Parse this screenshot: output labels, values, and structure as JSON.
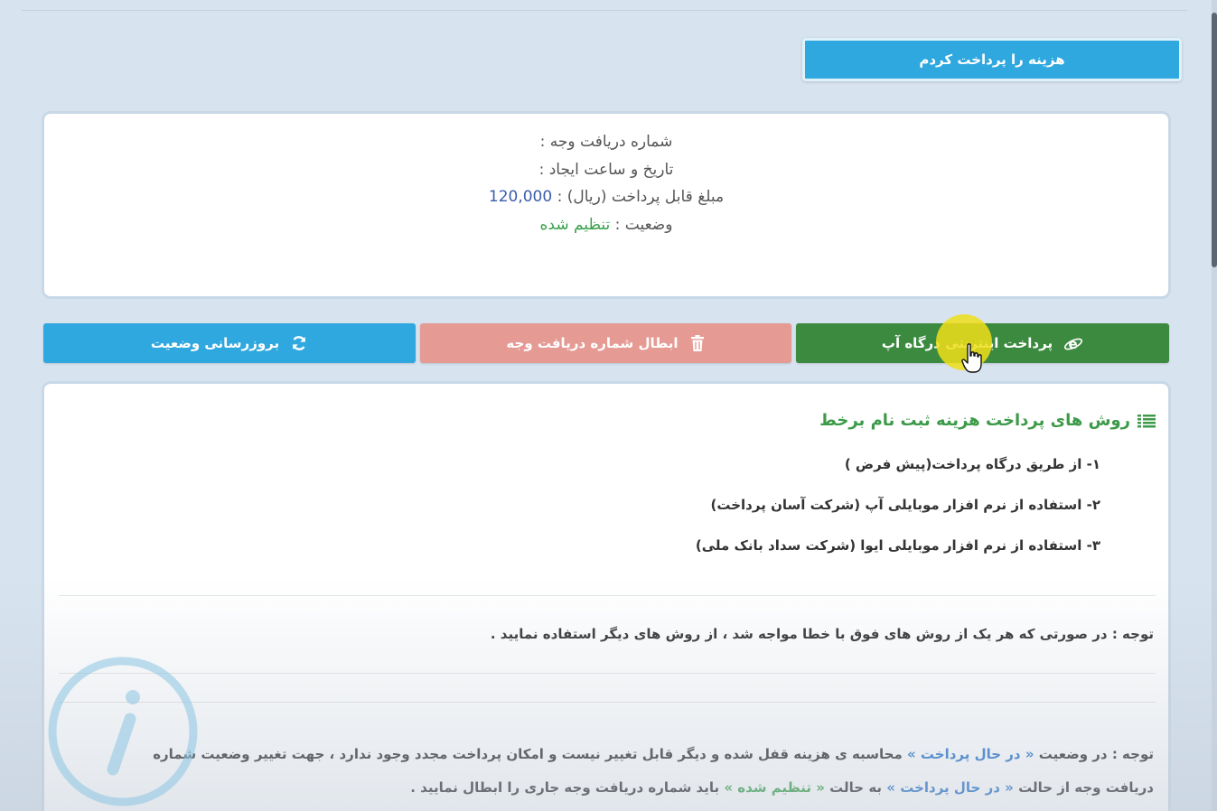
{
  "header": {
    "paid_button_label": "هزینه را پرداخت کردم"
  },
  "payment_info": {
    "receipt_number_label": "شماره دریافت وجه :",
    "created_datetime_label": "تاریخ و ساعت ایجاد :",
    "amount_label": "مبلغ قابل پرداخت (ریال) :",
    "amount_value": "120,000",
    "status_label": "وضعیت :",
    "status_value": "تنظیم شده"
  },
  "actions": {
    "pay_label": "پرداخت اینترنتی درگاه آپ",
    "cancel_label": "ابطال شماره دریافت وجه",
    "refresh_label": "بروزرسانی وضعیت"
  },
  "methods": {
    "title": "روش های پرداخت هزینه ثبت نام برخط",
    "items": [
      "۱- از طریق درگاه پرداخت(پیش فرض )",
      "۲- استفاده از نرم افزار موبایلی آپ (شرکت آسان پرداخت)",
      "۳- استفاده از نرم افزار موبایلی ایوا (شرکت سداد بانک ملی)"
    ],
    "note1": "توجه : در صورتی که هر یک از روش های فوق با خطا مواجه شد ، از روش های دیگر استفاده نمایید .",
    "note2": {
      "p1": "توجه : در وضعیت ",
      "status_paying": "« در حال پرداخت »",
      "p2": " محاسبه ی هزینه قفل شده و دیگر قابل تغییر نیست و امکان پرداخت مجدد وجود ندارد ، جهت تغییر وضعیت شماره دریافت وجه از حالت ",
      "p3": " به حالت ",
      "status_set": "« تنظیم شده »",
      "p4": " باید شماره دریافت وجه جاری را ابطال نمایید ."
    }
  },
  "colors": {
    "primary_blue": "#2fa8df",
    "success_green": "#3c8a40",
    "danger_pink": "#e69a94",
    "title_green": "#3c9a48",
    "link_blue": "#2a73c9",
    "highlight_yellow": "#eede1a"
  },
  "icons": {
    "pay": "internet-explorer-icon",
    "cancel": "trash-icon",
    "refresh": "refresh-icon",
    "methods": "list-icon",
    "watermark": "info-icon"
  }
}
